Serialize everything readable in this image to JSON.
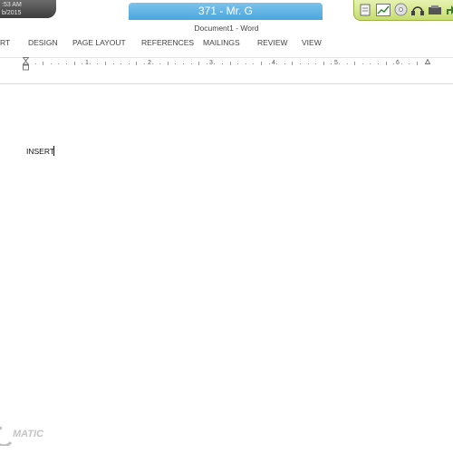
{
  "recorder": {
    "clock_time": ":53 AM",
    "clock_date": "b/2015",
    "title": "371 - Mr. G",
    "tray_icons": [
      "note-icon",
      "chart-icon",
      "disc-icon",
      "headset-icon",
      "tools-icon",
      "arrow-icon"
    ]
  },
  "document": {
    "title": "Document1 - Word",
    "tabs": [
      "RT",
      "DESIGN",
      "PAGE LAYOUT",
      "REFERENCES",
      "MAILINGS",
      "REVIEW",
      "VIEW"
    ],
    "ruler_numbers": [
      "1",
      "2",
      "3",
      "4",
      "5",
      "6"
    ],
    "body_text": "INSERT"
  },
  "watermark": {
    "text": "MATIC"
  },
  "colors": {
    "title_tab": "#4aa6dc",
    "tray": "#c6dd6e",
    "clock": "#4a4a4a"
  }
}
